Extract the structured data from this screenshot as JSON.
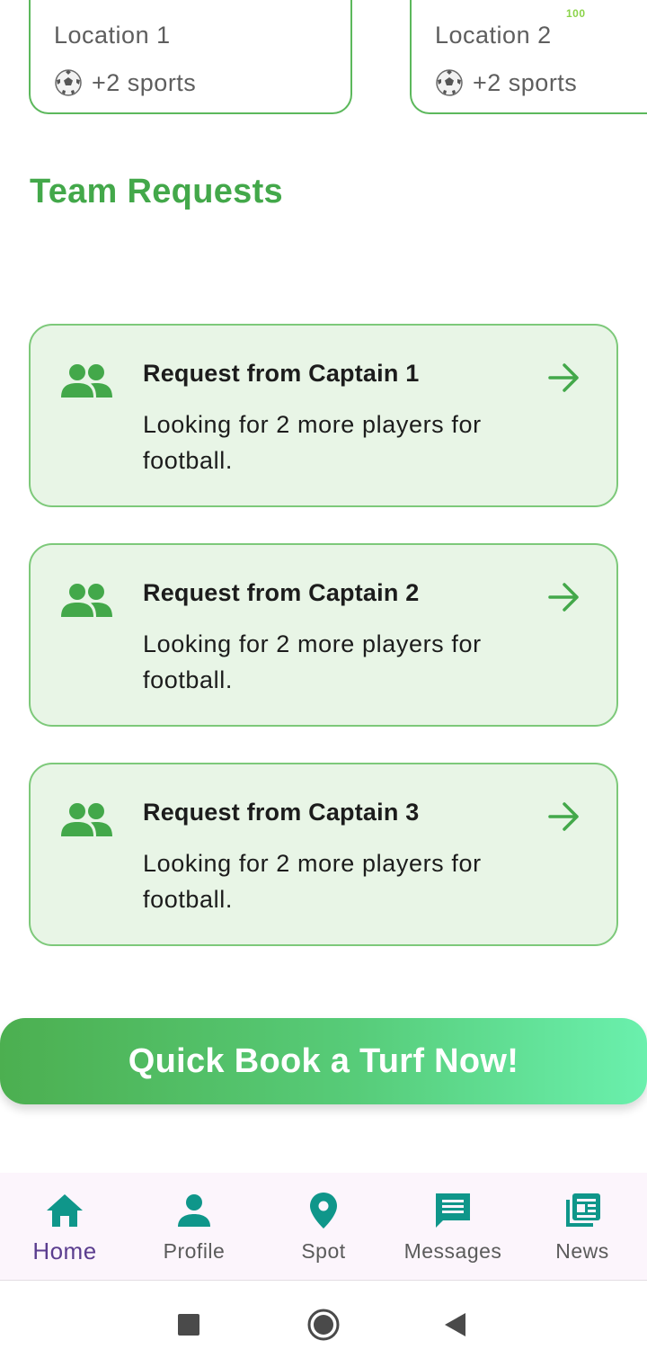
{
  "locations": [
    {
      "name": "Location 1",
      "sports": "+2 sports",
      "badge": ""
    },
    {
      "name": "Location 2",
      "sports": "+2 sports",
      "badge": "100"
    }
  ],
  "section_title": "Team Requests",
  "requests": [
    {
      "title": "Request from Captain 1",
      "body": "Looking for 2 more players for football."
    },
    {
      "title": "Request from Captain 2",
      "body": "Looking for 2 more players for football."
    },
    {
      "title": "Request from Captain 3",
      "body": "Looking for 2 more players for football."
    }
  ],
  "quick_book_label": "Quick Book a Turf Now!",
  "nav": {
    "items": [
      {
        "label": "Home",
        "icon": "home-icon",
        "active": true
      },
      {
        "label": "Profile",
        "icon": "person-icon"
      },
      {
        "label": "Spot",
        "icon": "location-pin-icon"
      },
      {
        "label": "Messages",
        "icon": "message-icon"
      },
      {
        "label": "News",
        "icon": "newspaper-icon"
      }
    ]
  },
  "system_nav": [
    "recent-apps-icon",
    "home-circle-icon",
    "back-icon"
  ],
  "colors": {
    "accent_green": "#43a84a",
    "card_bg": "#e8f5e6",
    "nav_icon_teal": "#0f968a",
    "active_label_purple": "#5b3d8f"
  }
}
